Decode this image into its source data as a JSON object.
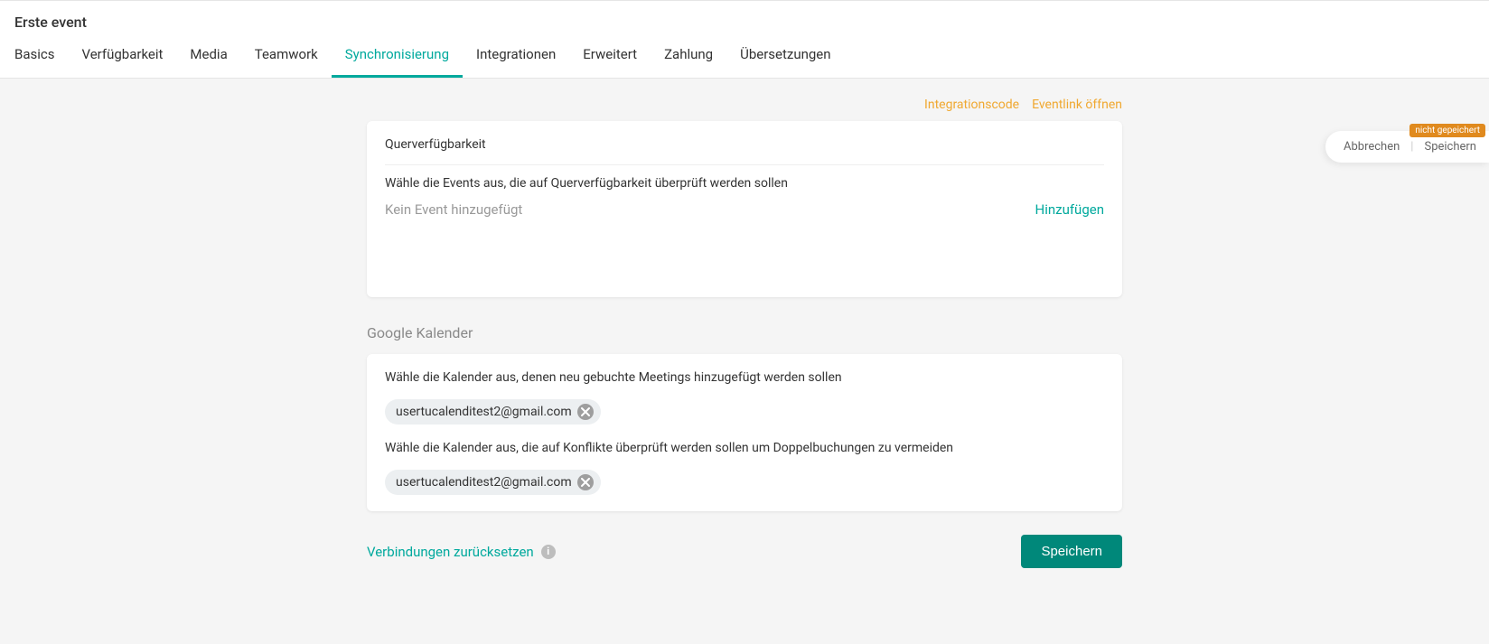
{
  "page": {
    "title": "Erste event"
  },
  "tabs": {
    "t0": "Basics",
    "t1": "Verfügbarkeit",
    "t2": "Media",
    "t3": "Teamwork",
    "t4": "Synchronisierung",
    "t5": "Integrationen",
    "t6": "Erweitert",
    "t7": "Zahlung",
    "t8": "Übersetzungen",
    "activeIndex": 4
  },
  "topLinks": {
    "integration": "Integrationscode",
    "open": "Eventlink öffnen"
  },
  "crossAvail": {
    "title": "Querverfügbarkeit",
    "desc": "Wähle die Events aus, die auf Querverfügbarkeit überprüft werden sollen",
    "empty": "Kein Event hinzugefügt",
    "addLabel": "Hinzufügen"
  },
  "google": {
    "heading": "Google Kalender",
    "field1Label": "Wähle die Kalender aus, denen neu gebuchte Meetings hinzugefügt werden sollen",
    "calendar1": "usertucalenditest2@gmail.com",
    "field2Label": "Wähle die Kalender aus, die auf Konflikte überprüft werden sollen um Doppelbuchungen zu vermeiden",
    "calendar2": "usertucalenditest2@gmail.com"
  },
  "actions": {
    "reset": "Verbindungen zurücksetzen",
    "save": "Speichern"
  },
  "floating": {
    "badge": "nicht gepeichert",
    "cancel": "Abbrechen",
    "save": "Speichern"
  }
}
